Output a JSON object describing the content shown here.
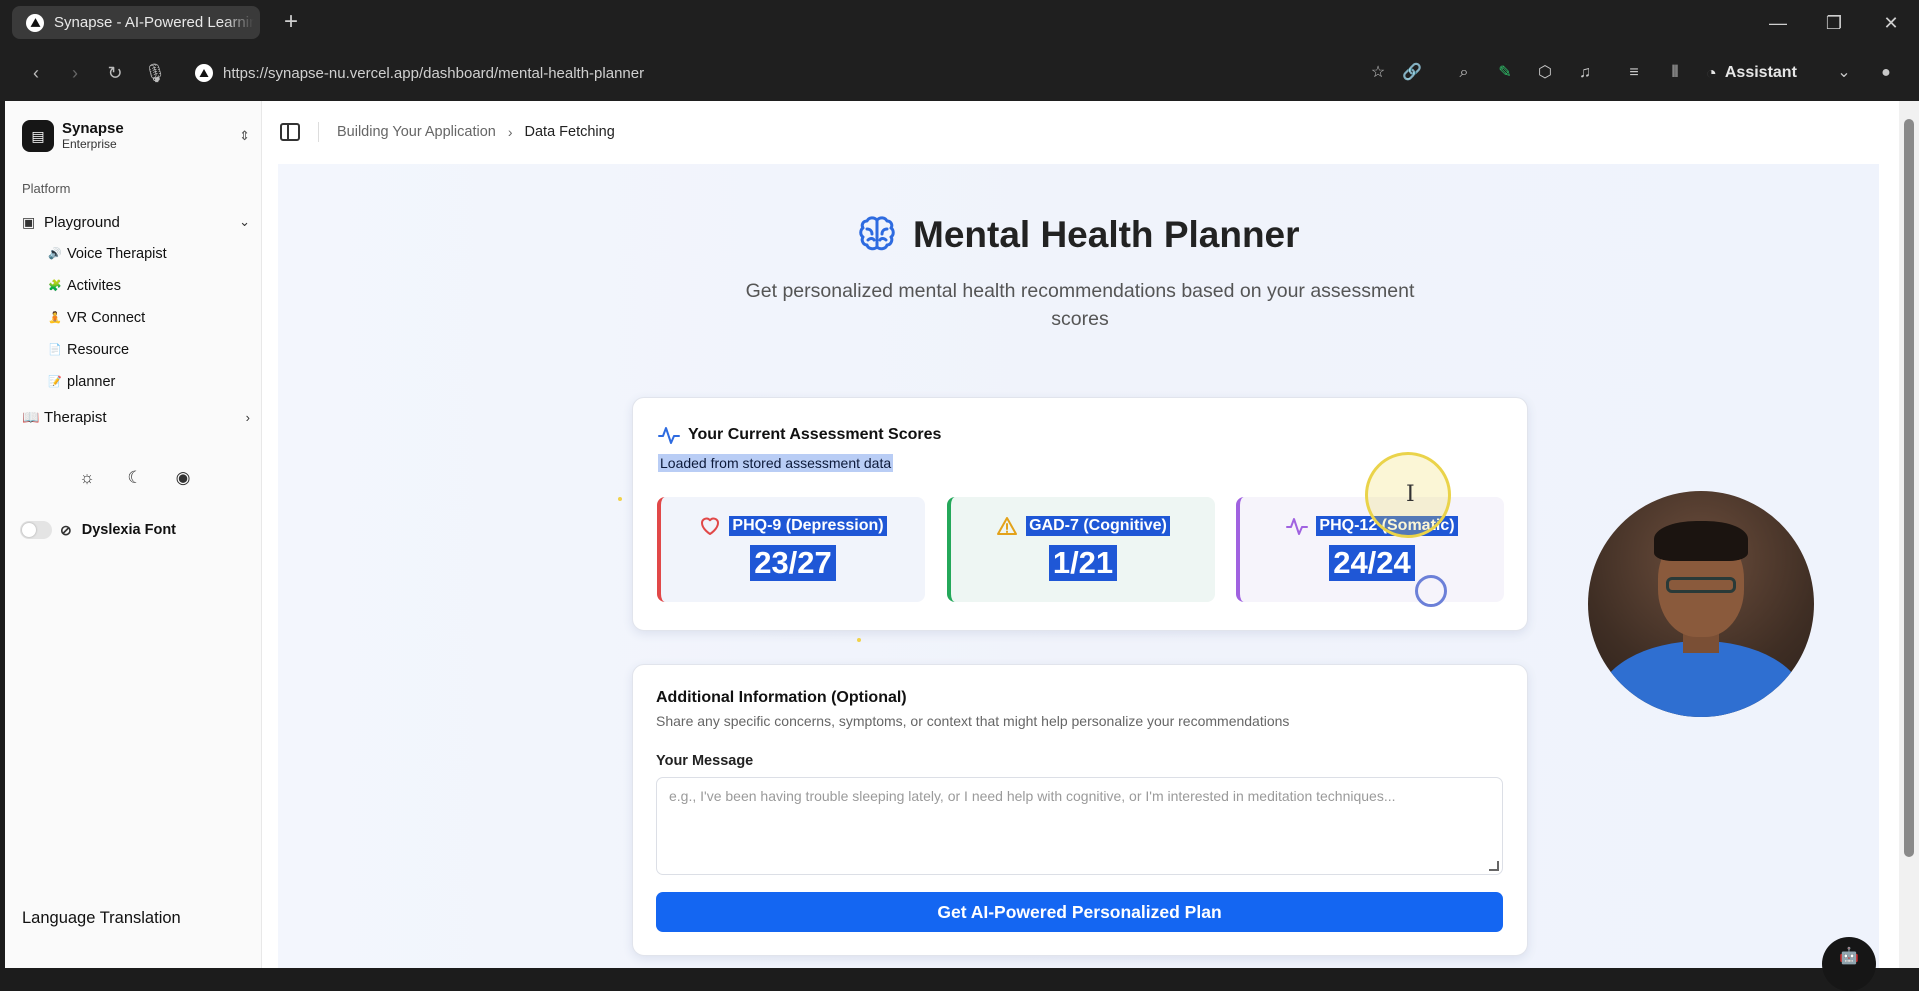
{
  "browser": {
    "tab_title": "Synapse - AI-Powered Learning",
    "new_tab": "+",
    "url": "https://synapse-nu.vercel.app/dashboard/mental-health-planner",
    "assistant_label": "Assistant"
  },
  "sidebar": {
    "org_name": "Synapse",
    "org_plan": "Enterprise",
    "group_label": "Platform",
    "playground_label": "Playground",
    "sub_items": [
      {
        "label": "Voice Therapist",
        "emoji": "🔊"
      },
      {
        "label": "Activites",
        "emoji": "🧩"
      },
      {
        "label": "VR Connect",
        "emoji": "🧘"
      },
      {
        "label": "Resource",
        "emoji": "📄"
      },
      {
        "label": "planner",
        "emoji": "📝"
      }
    ],
    "therapist_label": "Therapist",
    "dyslexia_label": "Dyslexia Font",
    "language_label": "Language Translation"
  },
  "breadcrumb": {
    "parent": "Building Your Application",
    "current": "Data Fetching"
  },
  "main": {
    "title": "Mental Health Planner",
    "subtitle": "Get personalized mental health recommendations based on your assessment scores"
  },
  "scores": {
    "heading": "Your Current Assessment Scores",
    "subheading": "Loaded from stored assessment data",
    "items": [
      {
        "label": "PHQ-9 (Depression)",
        "value": "23/27",
        "color": "#e14848"
      },
      {
        "label": "GAD-7 (Cognitive)",
        "value": "1/21",
        "color": "#24a85a"
      },
      {
        "label": "PHQ-12 (Somatic)",
        "value": "24/24",
        "color": "#a062e0"
      }
    ]
  },
  "info": {
    "title": "Additional Information (Optional)",
    "description": "Share any specific concerns, symptoms, or context that might help personalize your recommendations",
    "message_label": "Your Message",
    "message_placeholder": "e.g., I've been having trouble sleeping lately, or I need help with cognitive, or I'm interested in meditation techniques...",
    "button_label": "Get AI-Powered Personalized Plan"
  },
  "colors": {
    "accent": "#1466f2",
    "selection": "#1f57d6"
  }
}
